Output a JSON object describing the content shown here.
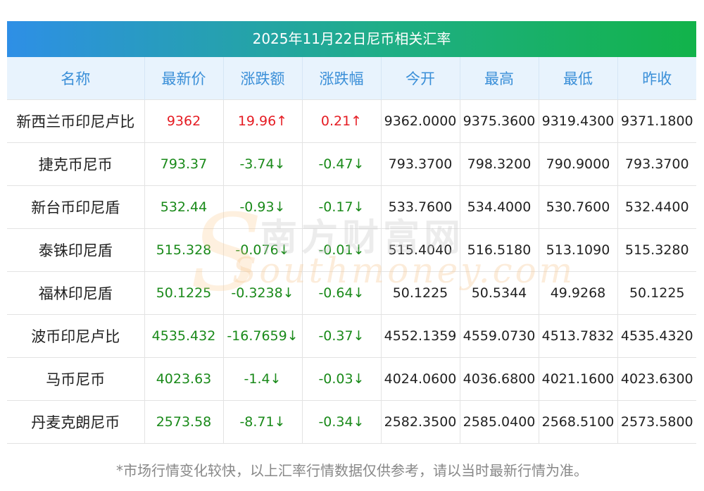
{
  "title": "2025年11月22日尼币相关汇率",
  "columns": [
    "名称",
    "最新价",
    "涨跌额",
    "涨跌幅",
    "今开",
    "最高",
    "最低",
    "昨收"
  ],
  "rows": [
    {
      "name": "新西兰币印尼卢比",
      "latest": "9362",
      "change": "19.96↑",
      "pct": "0.21↑",
      "open": "9362.0000",
      "high": "9375.3600",
      "low": "9319.4300",
      "prev": "9371.1800",
      "dir": "up"
    },
    {
      "name": "捷克币尼币",
      "latest": "793.37",
      "change": "-3.74↓",
      "pct": "-0.47↓",
      "open": "793.3700",
      "high": "798.3200",
      "low": "790.9000",
      "prev": "793.3700",
      "dir": "down"
    },
    {
      "name": "新台币印尼盾",
      "latest": "532.44",
      "change": "-0.93↓",
      "pct": "-0.17↓",
      "open": "533.7600",
      "high": "534.4000",
      "low": "530.7600",
      "prev": "532.4400",
      "dir": "down"
    },
    {
      "name": "泰铢印尼盾",
      "latest": "515.328",
      "change": "-0.076↓",
      "pct": "-0.01↓",
      "open": "515.4040",
      "high": "516.5180",
      "low": "513.1090",
      "prev": "515.3280",
      "dir": "down"
    },
    {
      "name": "福林印尼盾",
      "latest": "50.1225",
      "change": "-0.3238↓",
      "pct": "-0.64↓",
      "open": "50.1225",
      "high": "50.5344",
      "low": "49.9268",
      "prev": "50.1225",
      "dir": "down"
    },
    {
      "name": "波币印尼卢比",
      "latest": "4535.432",
      "change": "-16.7659↓",
      "pct": "-0.37↓",
      "open": "4552.1359",
      "high": "4559.0730",
      "low": "4513.7832",
      "prev": "4535.4320",
      "dir": "down"
    },
    {
      "name": "马币尼币",
      "latest": "4023.63",
      "change": "-1.4↓",
      "pct": "-0.03↓",
      "open": "4024.0600",
      "high": "4036.6800",
      "low": "4021.1600",
      "prev": "4023.6300",
      "dir": "down"
    },
    {
      "name": "丹麦克朗尼币",
      "latest": "2573.58",
      "change": "-8.71↓",
      "pct": "-0.34↓",
      "open": "2582.3500",
      "high": "2585.0400",
      "low": "2568.5100",
      "prev": "2573.5800",
      "dir": "down"
    }
  ],
  "footnote": "*市场行情变化较快，以上汇率行情数据仅供参考，请以当时最新行情为准。",
  "watermark": {
    "cn": "南方财富网",
    "en": "Southmoney.com"
  },
  "colors": {
    "up": "#e51c23",
    "down": "#1a8a1a",
    "header_text": "#3a8fd8"
  }
}
